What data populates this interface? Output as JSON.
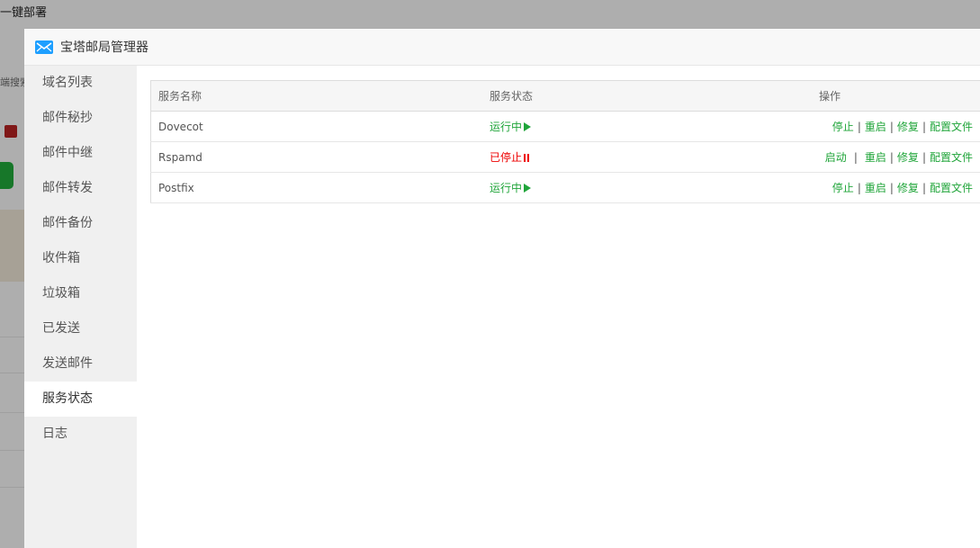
{
  "background": {
    "title": "一键部署",
    "search_placeholder": "端搜索"
  },
  "modal": {
    "title": "宝塔邮局管理器",
    "icon": "mail-icon"
  },
  "sidebar": {
    "items": [
      {
        "label": "域名列表"
      },
      {
        "label": "邮件秘抄"
      },
      {
        "label": "邮件中继"
      },
      {
        "label": "邮件转发"
      },
      {
        "label": "邮件备份"
      },
      {
        "label": "收件箱"
      },
      {
        "label": "垃圾箱"
      },
      {
        "label": "已发送"
      },
      {
        "label": "发送邮件"
      },
      {
        "label": "服务状态",
        "active": true
      },
      {
        "label": "日志"
      }
    ]
  },
  "table": {
    "headers": {
      "name": "服务名称",
      "status": "服务状态",
      "ops": "操作"
    },
    "rows": [
      {
        "name": "Dovecot",
        "status": "运行中",
        "status_icon": "play-icon",
        "running": true,
        "ops": [
          "停止",
          "重启",
          "修复",
          "配置文件"
        ]
      },
      {
        "name": "Rspamd",
        "status": "已停止",
        "status_icon": "pause-icon",
        "running": false,
        "ops": [
          "启动",
          "重启",
          "修复",
          "配置文件"
        ]
      },
      {
        "name": "Postfix",
        "status": "运行中",
        "status_icon": "play-icon",
        "running": true,
        "ops": [
          "停止",
          "重启",
          "修复",
          "配置文件"
        ]
      }
    ]
  },
  "colors": {
    "accent_green": "#20a53a",
    "stop_red": "#e00000",
    "mail_blue": "#1e9fff"
  }
}
